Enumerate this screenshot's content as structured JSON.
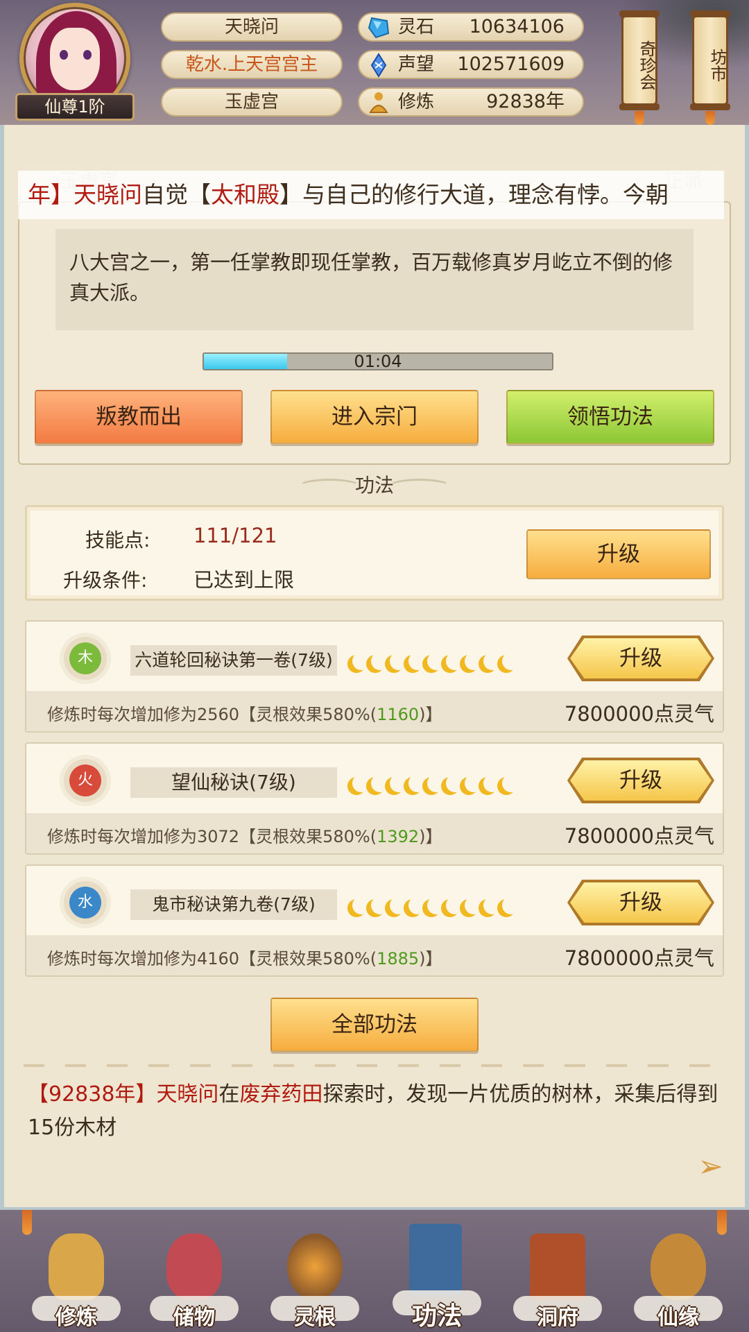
{
  "player": {
    "name": "天晓问",
    "title": "乾水.上天宫宫主",
    "sect": "玉虚宫",
    "rank": "仙尊1阶"
  },
  "resources": [
    {
      "label": "灵石",
      "value": "10634106",
      "icon": "spirit-stone-icon",
      "color": "#3aa8e8"
    },
    {
      "label": "声望",
      "value": "102571609",
      "icon": "prestige-crystal-icon",
      "color": "#3a7ee0"
    },
    {
      "label": "修炼",
      "value": "92838年",
      "icon": "meditation-icon",
      "color": "#e0a030"
    }
  ],
  "side_buttons": [
    {
      "label": "奇珍会"
    },
    {
      "label": "坊市"
    }
  ],
  "sect_panel": {
    "faded_left": "玉虚宫",
    "faded_right": "正派",
    "marquee": {
      "p1": "年】",
      "name": "天晓问",
      "p2": "自觉【",
      "hall": "太和殿",
      "p3": "】与自己的修行大道，理念有悖。今朝"
    },
    "description": "八大宫之一，第一任掌教即现任掌教，百万载修真岁月屹立不倒的修真大派。",
    "timer": "01:04",
    "timer_progress": 0.24,
    "buttons": {
      "leave": "叛教而出",
      "enter": "进入宗门",
      "learn": "领悟功法"
    }
  },
  "skills_section": {
    "title": "功法",
    "points_label": "技能点:",
    "points_value": "111/121",
    "condition_label": "升级条件:",
    "condition_value": "已达到上限",
    "upgrade_label": "升级",
    "colors": {
      "points": "#9a2a1a"
    }
  },
  "techniques": [
    {
      "element": "木",
      "element_color": "#7cba3c",
      "name": "六道轮回秘诀第一卷(7级)",
      "moons": 9,
      "upgrade_label": "升级",
      "effect_prefix": "修炼时每次增加修为2560【灵根效果580%(",
      "effect_bonus": "1160",
      "effect_suffix": ")】",
      "cost": "7800000点灵气"
    },
    {
      "element": "火",
      "element_color": "#d84a3a",
      "name": "望仙秘诀(7级)",
      "moons": 9,
      "upgrade_label": "升级",
      "effect_prefix": "修炼时每次增加修为3072【灵根效果580%(",
      "effect_bonus": "1392",
      "effect_suffix": ")】",
      "cost": "7800000点灵气"
    },
    {
      "element": "水",
      "element_color": "#3a88c8",
      "name": "鬼市秘诀第九卷(7级)",
      "moons": 9,
      "upgrade_label": "升级",
      "effect_prefix": "修炼时每次增加修为4160【灵根效果580%(",
      "effect_bonus": "1885",
      "effect_suffix": ")】",
      "cost": "7800000点灵气"
    }
  ],
  "all_techniques_label": "全部功法",
  "log": {
    "year": "【92838年】",
    "name": "天晓问",
    "p1": "在",
    "place": "废弃药田",
    "p2": "探索时，发现一片优质的树林，采集后得到15份木材"
  },
  "bottom_nav": [
    {
      "label": "修炼",
      "icon": "cultivate-icon",
      "color": "#d9a64a"
    },
    {
      "label": "储物",
      "icon": "storage-bag-icon",
      "color": "#c24a52"
    },
    {
      "label": "灵根",
      "icon": "spirit-root-icon",
      "color": "#8c5a2a"
    },
    {
      "label": "功法",
      "icon": "technique-book-icon",
      "color": "#3e6a9c"
    },
    {
      "label": "洞府",
      "icon": "cave-house-icon",
      "color": "#b0502a"
    },
    {
      "label": "仙缘",
      "icon": "gourd-icon",
      "color": "#c48a3a"
    }
  ]
}
